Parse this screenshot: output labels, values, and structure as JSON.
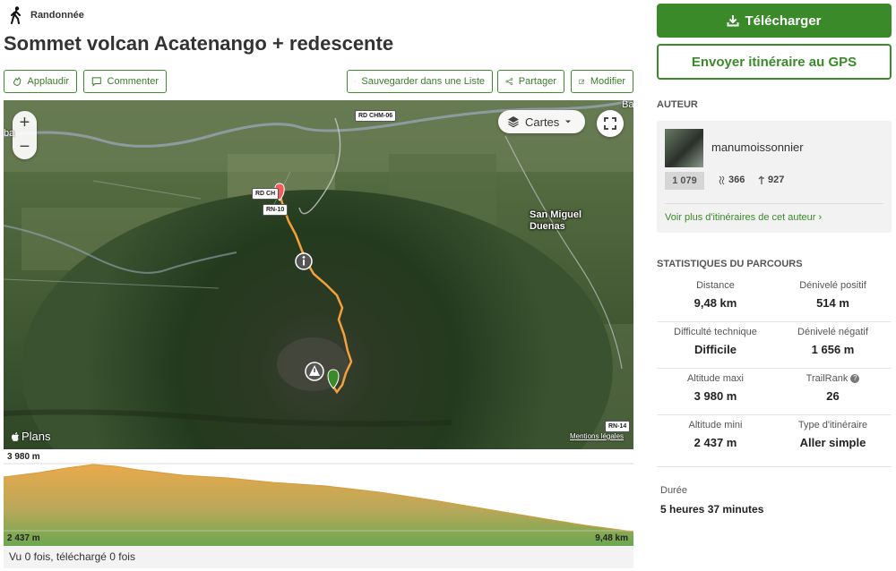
{
  "header": {
    "activity_icon": "hiking-icon",
    "activity": "Randonnée",
    "title": "Sommet volcan Acatenango + redescente"
  },
  "actions": [
    {
      "label": "Applaudir",
      "icon": "clap-icon"
    },
    {
      "label": "Commenter",
      "icon": "comment-icon"
    },
    {
      "label": "Sauvegarder dans une Liste",
      "icon": "bookmark-icon"
    },
    {
      "label": "Partager",
      "icon": "share-icon"
    },
    {
      "label": "Modifier",
      "icon": "edit-icon"
    }
  ],
  "map": {
    "layer_button": "Cartes",
    "zoom_in": "+",
    "zoom_out": "−",
    "roads": [
      "RD CHM-06",
      "RD CH",
      "RN-10",
      "RN-14"
    ],
    "places": [
      "San Miguel",
      "Duenas"
    ],
    "edge_labels": [
      "Ba",
      "ba"
    ],
    "attribution": "Plans",
    "legal": "Mentions légales",
    "track_color": "#f5a03a",
    "start_color": "#3a8a2a",
    "end_color": "#f25c5c"
  },
  "profile": {
    "max_label": "3 980 m",
    "min_label": "2 437 m",
    "distance_label": "9,48 km",
    "fill_top": "#e9a94a",
    "fill_bottom": "#6aa84f"
  },
  "footer": {
    "views": "Vu 0 fois, téléchargé 0 fois"
  },
  "sidebar": {
    "download": "Télécharger",
    "send_gps": "Envoyer itinéraire au GPS",
    "author_heading": "AUTEUR",
    "author": {
      "name": "manumoissonnier",
      "rank": "1 079",
      "followers": "366",
      "trails": "927",
      "more_link": "Voir plus d'itinéraires de cet auteur ›"
    },
    "stats_heading": "STATISTIQUES DU PARCOURS",
    "stats": [
      [
        {
          "label": "Distance",
          "value": "9,48 km"
        },
        {
          "label": "Dénivelé positif",
          "value": "514 m"
        }
      ],
      [
        {
          "label": "Difficulté technique",
          "value": "Difficile"
        },
        {
          "label": "Dénivelé négatif",
          "value": "1 656 m"
        }
      ],
      [
        {
          "label": "Altitude maxi",
          "value": "3 980 m"
        },
        {
          "label": "TrailRank",
          "value": "26"
        }
      ],
      [
        {
          "label": "Altitude mini",
          "value": "2 437 m"
        },
        {
          "label": "Type d'itinéraire",
          "value": "Aller simple"
        }
      ]
    ],
    "duration_label": "Durée",
    "duration_value": "5 heures 37 minutes"
  },
  "colors": {
    "accent": "#3a8a2a",
    "accent_text": "#3a7d2a"
  }
}
